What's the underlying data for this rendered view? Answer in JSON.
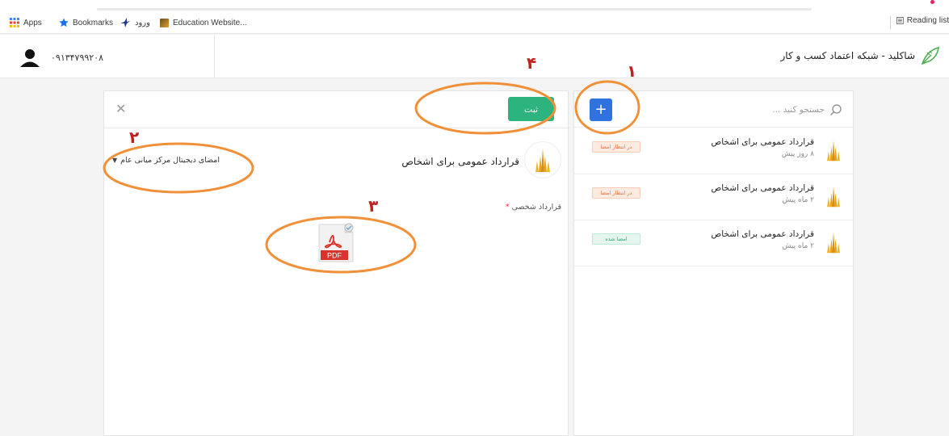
{
  "browser": {
    "bookmarks": [
      {
        "label": "Apps",
        "icon": "apps-grid-icon"
      },
      {
        "label": "Bookmarks",
        "icon": "star-icon"
      },
      {
        "label": "ورود",
        "icon": "bird-icon"
      },
      {
        "label": "Education Website...",
        "icon": "site-favicon-icon"
      }
    ],
    "reading_list": "Reading list"
  },
  "header": {
    "phone": "۰۹۱۳۴۷۹۹۲۰۸",
    "brand_title": "شاکلید - شبکه اعتماد کسب و کار",
    "brand_icon": "feather-logo-icon"
  },
  "editor": {
    "submit_label": "ثبت",
    "close_icon": "close-icon",
    "doc_title": "قرارداد عمومی برای اشخاص",
    "sign_method": "امضای دیجیتال مرکز میانی عام",
    "field_label": "قرارداد شخصی",
    "required_mark": "*",
    "file_badge": "PDF",
    "file_icon": "pdf-file-icon"
  },
  "sidebar": {
    "search_placeholder": "جستجو کنید ...",
    "add_label": "+",
    "items": [
      {
        "title": "قرارداد عمومی برای اشخاص",
        "time": "۸ روز پیش",
        "status": "در انتظار امضا",
        "status_type": "pending"
      },
      {
        "title": "قرارداد عمومی برای اشخاص",
        "time": "۲ ماه پیش",
        "status": "در انتظار امضا",
        "status_type": "pending"
      },
      {
        "title": "قرارداد عمومی برای اشخاص",
        "time": "۲ ماه پیش",
        "status": "امضا شده",
        "status_type": "signed"
      }
    ]
  },
  "annotations": {
    "marks": [
      "۱",
      "۲",
      "۳",
      "۴"
    ],
    "ellipse_color": "#f0913a",
    "number_color": "#c22020"
  },
  "colors": {
    "submit": "#2db37d",
    "add": "#2f72e0",
    "pending": "#e0723b",
    "signed": "#3aa877"
  }
}
